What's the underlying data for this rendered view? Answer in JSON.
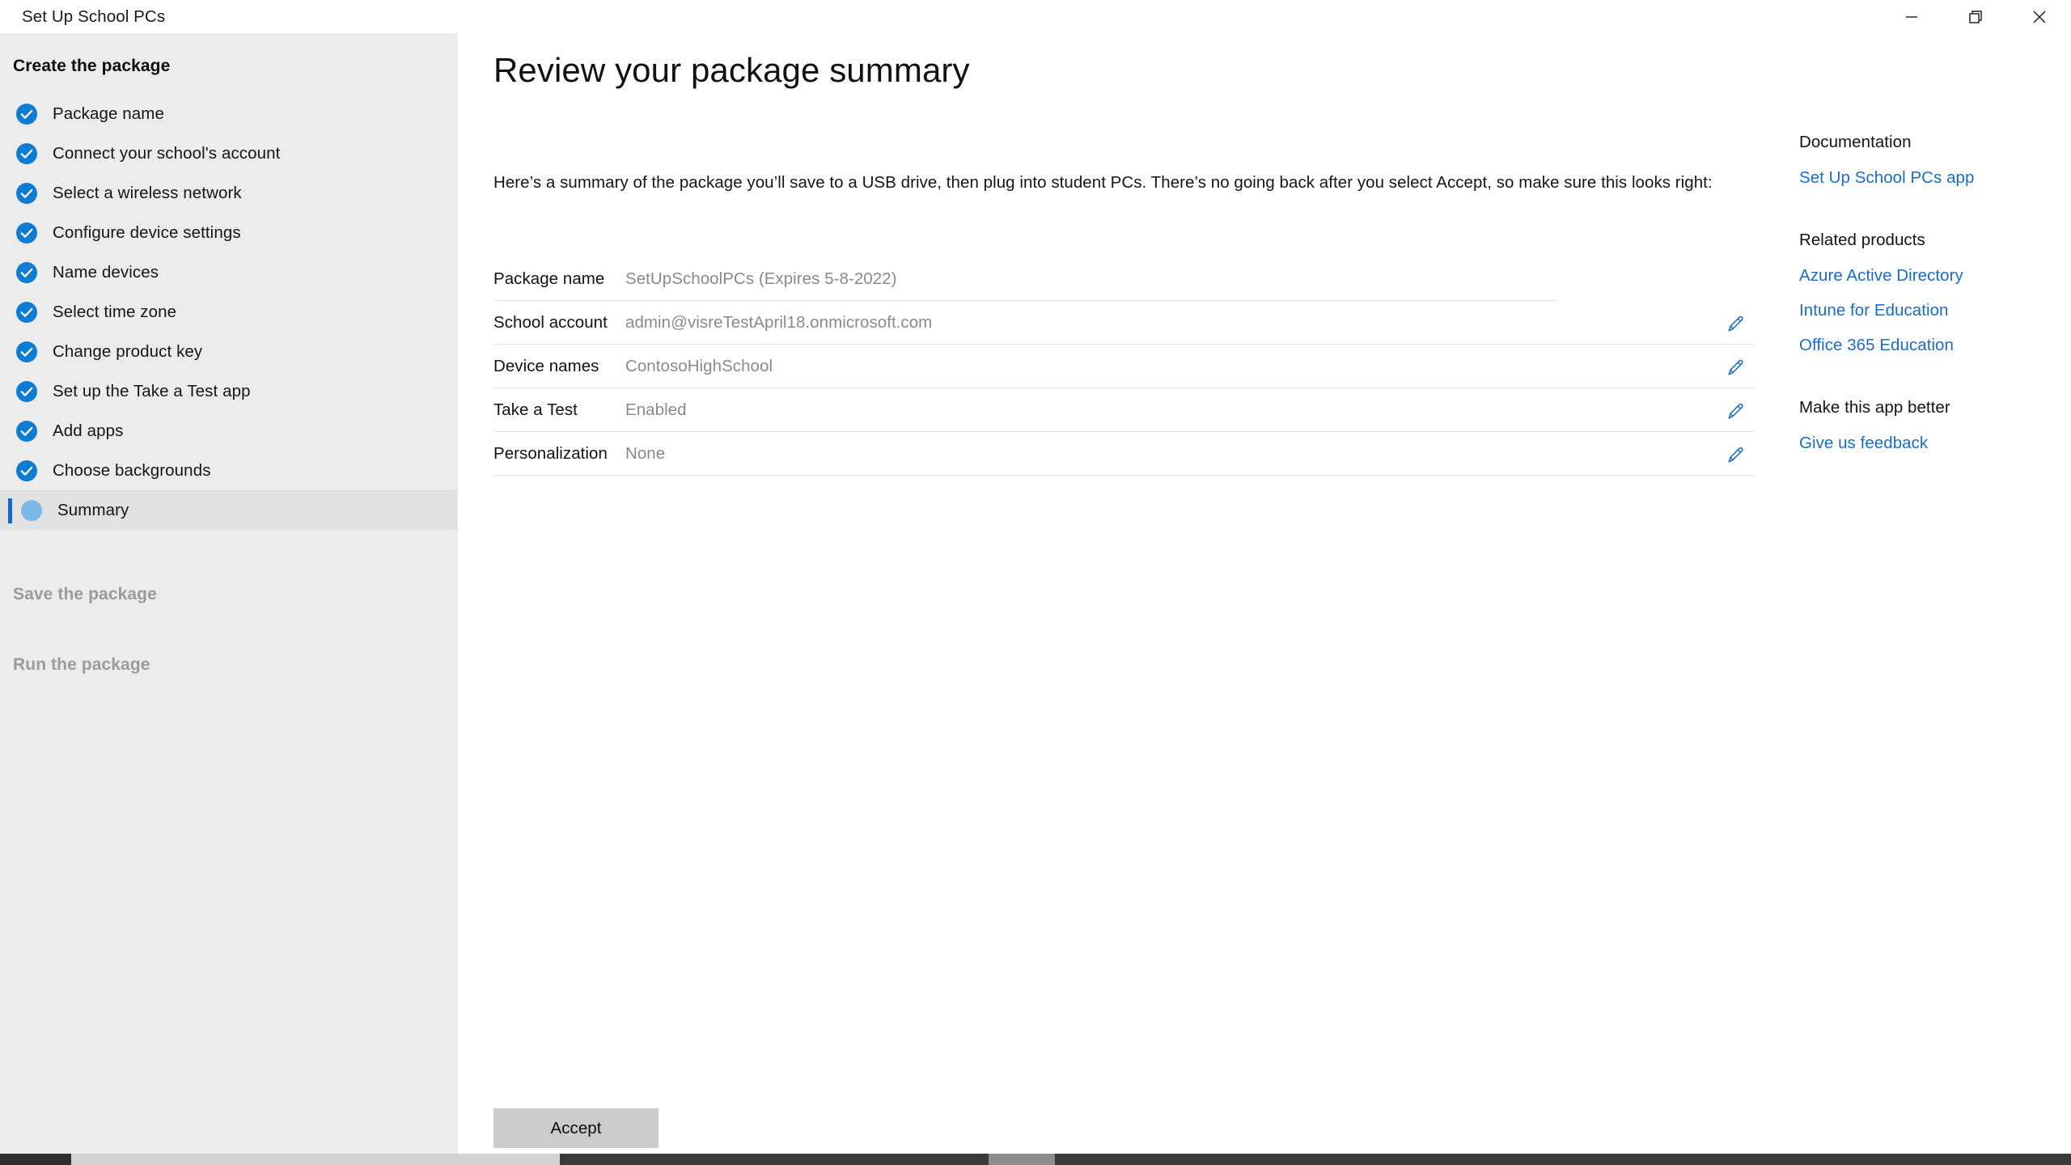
{
  "window": {
    "title": "Set Up School PCs",
    "controls": [
      {
        "name": "minimize",
        "label": "Minimize"
      },
      {
        "name": "restore",
        "label": "Restore"
      },
      {
        "name": "close",
        "label": "Close"
      }
    ]
  },
  "sidebar": {
    "sections": [
      {
        "title": "Create the package",
        "enabled": true
      },
      {
        "title": "Save the package",
        "enabled": false
      },
      {
        "title": "Run the package",
        "enabled": false
      }
    ],
    "items": [
      {
        "label": "Package name",
        "state": "done"
      },
      {
        "label": "Connect your school's account",
        "state": "done"
      },
      {
        "label": "Select a wireless network",
        "state": "done"
      },
      {
        "label": "Configure device settings",
        "state": "done"
      },
      {
        "label": "Name devices",
        "state": "done"
      },
      {
        "label": "Select time zone",
        "state": "done"
      },
      {
        "label": "Change product key",
        "state": "done"
      },
      {
        "label": "Set up the Take a Test app",
        "state": "done"
      },
      {
        "label": "Add apps",
        "state": "done"
      },
      {
        "label": "Choose backgrounds",
        "state": "done"
      },
      {
        "label": "Summary",
        "state": "current"
      }
    ]
  },
  "main": {
    "title": "Review your package summary",
    "intro": "Here’s a summary of the package you’ll save to a USB drive, then plug into student PCs. There’s no going back after you select Accept, so make sure this looks right:",
    "summary_rows": [
      {
        "key": "Package name",
        "value": "SetUpSchoolPCs (Expires 5-8-2022)",
        "editable": false
      },
      {
        "key": "School account",
        "value": "admin@visreTestApril18.onmicrosoft.com",
        "editable": true
      },
      {
        "key": "Device names",
        "value": "ContosoHighSchool",
        "editable": true
      },
      {
        "key": "Take a Test",
        "value": "Enabled",
        "editable": true
      },
      {
        "key": "Personalization",
        "value": "None",
        "editable": true
      }
    ],
    "accept_label": "Accept"
  },
  "rail": {
    "groups": [
      {
        "heading": "Documentation",
        "links": [
          "Set Up School PCs app"
        ]
      },
      {
        "heading": "Related products",
        "links": [
          "Azure Active Directory",
          "Intune for Education",
          "Office 365 Education"
        ]
      },
      {
        "heading": "Make this app better",
        "links": [
          "Give us feedback"
        ]
      }
    ]
  },
  "colors": {
    "accent_blue": "#0f7cd4",
    "link_blue": "#1a6cc4",
    "current_step_blue": "#7cb9e8",
    "sidebar_bg": "#ececec",
    "selected_bg": "#e2e2e2",
    "value_gray": "#8a8a8a",
    "button_gray": "#cccccc"
  }
}
